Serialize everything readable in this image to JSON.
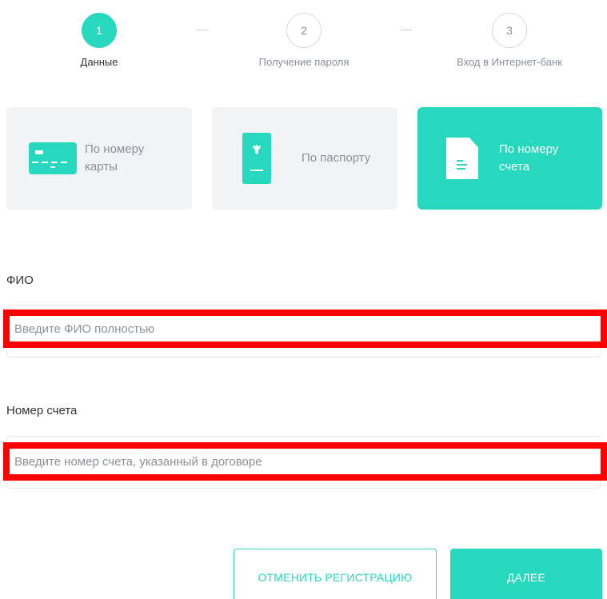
{
  "colors": {
    "accent": "#27d8be",
    "highlight": "#ff0000",
    "card_bg": "#f2f3f5",
    "muted_text": "#8a9099"
  },
  "steps": [
    {
      "number": "1",
      "label": "Данные",
      "active": true
    },
    {
      "number": "2",
      "label": "Получение пароля",
      "active": false
    },
    {
      "number": "3",
      "label": "Вход в Интернет-банк",
      "active": false
    }
  ],
  "methods": {
    "card": {
      "line1": "По номеру",
      "line2": "карты",
      "icon": "bank-card-icon"
    },
    "passport": {
      "line1": "По паспорту",
      "icon": "passport-icon"
    },
    "account": {
      "line1": "По номеру",
      "line2": "счета",
      "icon": "document-icon",
      "selected": true
    }
  },
  "form": {
    "fio": {
      "label": "ФИО",
      "placeholder": "Введите ФИО полностью",
      "value": ""
    },
    "account_number": {
      "label": "Номер счета",
      "placeholder": "Введите номер счета, указанный в договоре",
      "value": ""
    }
  },
  "buttons": {
    "cancel": "ОТМЕНИТЬ РЕГИСТРАЦИЮ",
    "next": "ДАЛЕЕ"
  }
}
